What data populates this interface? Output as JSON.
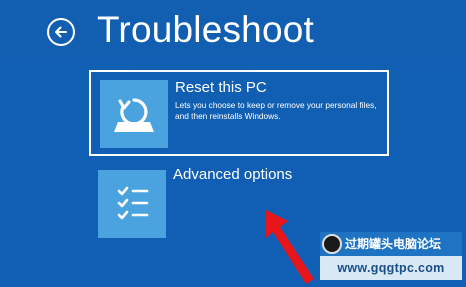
{
  "header": {
    "title": "Troubleshoot",
    "back_icon": "back-arrow-circle-icon"
  },
  "options": [
    {
      "title": "Reset this PC",
      "description": "Lets you choose to keep or remove your personal files, and then reinstalls Windows.",
      "icon": "reset-pc-icon",
      "selected": true
    },
    {
      "title": "Advanced options",
      "icon": "checklist-icon",
      "selected": false
    }
  ],
  "annotation": {
    "arrow_color": "#e8151b",
    "arrow_icon": "red-pointer-arrow-icon"
  },
  "watermark": {
    "name": "过期罐头电脑论坛",
    "url": "www.gqgtpc.com"
  },
  "colors": {
    "background": "#0f5fb5",
    "tile": "#4aa3df",
    "text": "#ffffff"
  }
}
